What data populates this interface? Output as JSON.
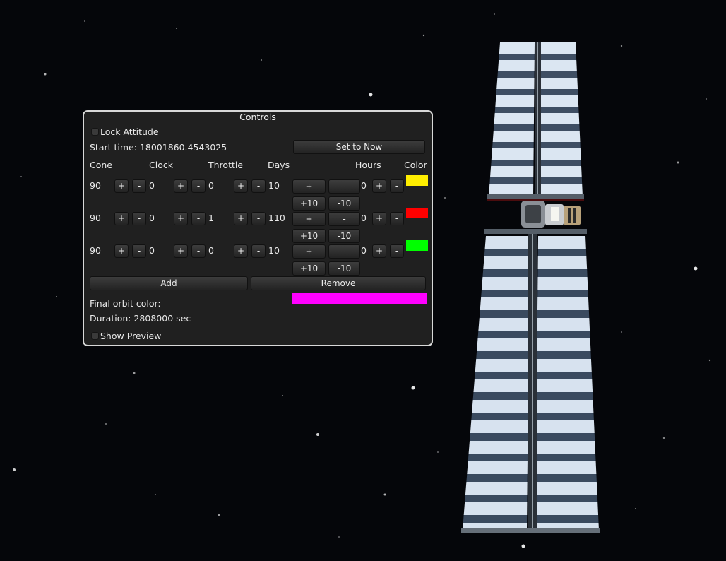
{
  "window": {
    "title": "Controls",
    "lock_attitude_label": "Lock Attitude",
    "start_time_label": "Start time: 18001860.4543025",
    "set_to_now_label": "Set to Now",
    "headers": {
      "cone": "Cone",
      "clock": "Clock",
      "throttle": "Throttle",
      "days": "Days",
      "hours": "Hours",
      "color": "Color"
    },
    "rows": [
      {
        "cone": "90",
        "clock": "0",
        "throttle": "0",
        "days": "10",
        "hours": "0",
        "color": "#ffee00"
      },
      {
        "cone": "90",
        "clock": "0",
        "throttle": "1",
        "days": "110",
        "hours": "0",
        "color": "#ff0000"
      },
      {
        "cone": "90",
        "clock": "0",
        "throttle": "0",
        "days": "10",
        "hours": "0",
        "color": "#00ff00"
      }
    ],
    "plus": "+",
    "minus": "-",
    "plus10": "+10",
    "minus10": "-10",
    "add_label": "Add",
    "remove_label": "Remove",
    "final_orbit_color_label": "Final orbit color:",
    "final_orbit_color": "#ff00ff",
    "duration_label": "Duration: 2808000 sec",
    "show_preview_label": "Show Preview"
  }
}
